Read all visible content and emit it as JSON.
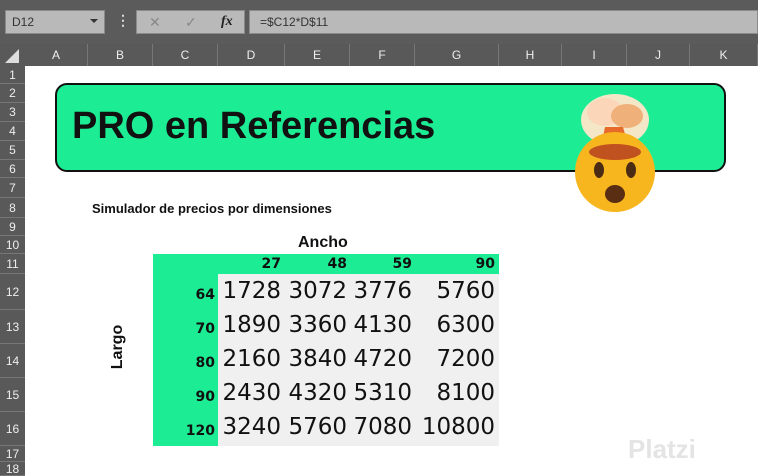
{
  "formula_bar": {
    "name_box": "D12",
    "formula": "=$C12*D$11",
    "cancel_icon": "✕",
    "enter_icon": "✓",
    "fx_label": "fx"
  },
  "columns": [
    "A",
    "B",
    "C",
    "D",
    "E",
    "F",
    "G",
    "H",
    "I",
    "J",
    "K"
  ],
  "rows": [
    "1",
    "2",
    "3",
    "4",
    "5",
    "6",
    "7",
    "8",
    "9",
    "10",
    "11",
    "12",
    "13",
    "14",
    "15",
    "16",
    "17",
    "18"
  ],
  "banner": {
    "title": "PRO en Referencias",
    "emoji": "exploding-head"
  },
  "subtitle": "Simulador de precios por dimensiones",
  "table": {
    "col_axis_label": "Ancho",
    "row_axis_label": "Largo",
    "col_headers": [
      "27",
      "48",
      "59",
      "90"
    ],
    "row_headers": [
      "64",
      "70",
      "80",
      "90",
      "120"
    ],
    "values": [
      [
        "1728",
        "3072",
        "3776",
        "5760"
      ],
      [
        "1890",
        "3360",
        "4130",
        "6300"
      ],
      [
        "2160",
        "3840",
        "4720",
        "7200"
      ],
      [
        "2430",
        "4320",
        "5310",
        "8100"
      ],
      [
        "3240",
        "5760",
        "7080",
        "10800"
      ]
    ]
  },
  "watermark": "Platzi",
  "colors": {
    "accent": "#1ced94",
    "header_bg": "#595959"
  }
}
